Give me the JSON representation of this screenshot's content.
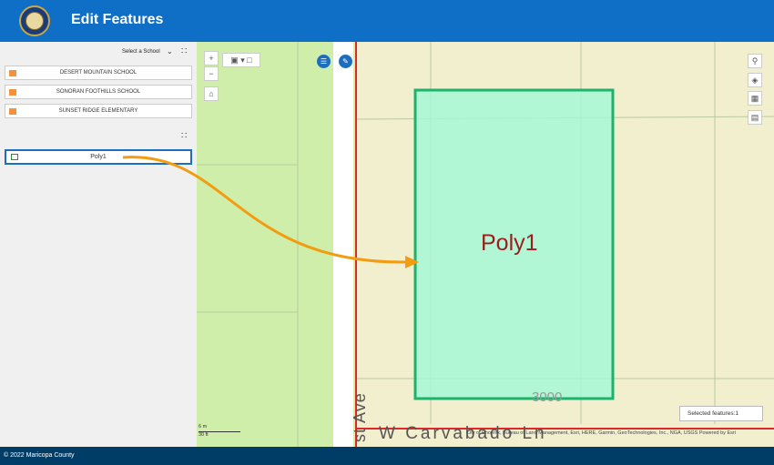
{
  "header": {
    "title": "Edit Features"
  },
  "panel": {
    "select_label": "Select a School",
    "schools": [
      {
        "label": "DESERT MOUNTAIN SCHOOL"
      },
      {
        "label": "SONORAN FOOTHILLS SCHOOL"
      },
      {
        "label": "SUNSET RIDGE ELEMENTARY"
      }
    ],
    "feature": {
      "label": "Poly1"
    }
  },
  "map": {
    "poly_label": "Poly1",
    "street_vertical": "st Ave",
    "street_horizontal": "W Carvabado Ln",
    "address": "3000",
    "selected_features": "Selected features:1",
    "attribution": "City of Phoenix, Bureau of Land Management, Esri, HERE, Garmin, GeoTechnologies, Inc., NGA, USGS",
    "powered_by": "Powered by Esri",
    "scale_m": "6 m",
    "scale_ft": "30 ft"
  },
  "footer": {
    "copyright": "© 2022 Maricopa County"
  },
  "colors": {
    "header": "#0f6fc6",
    "footer": "#003d66",
    "poly_fill": "#a6f7d6",
    "poly_stroke": "#1db36a",
    "school_swatch": "#f5913a",
    "arrow": "#f39c12"
  }
}
